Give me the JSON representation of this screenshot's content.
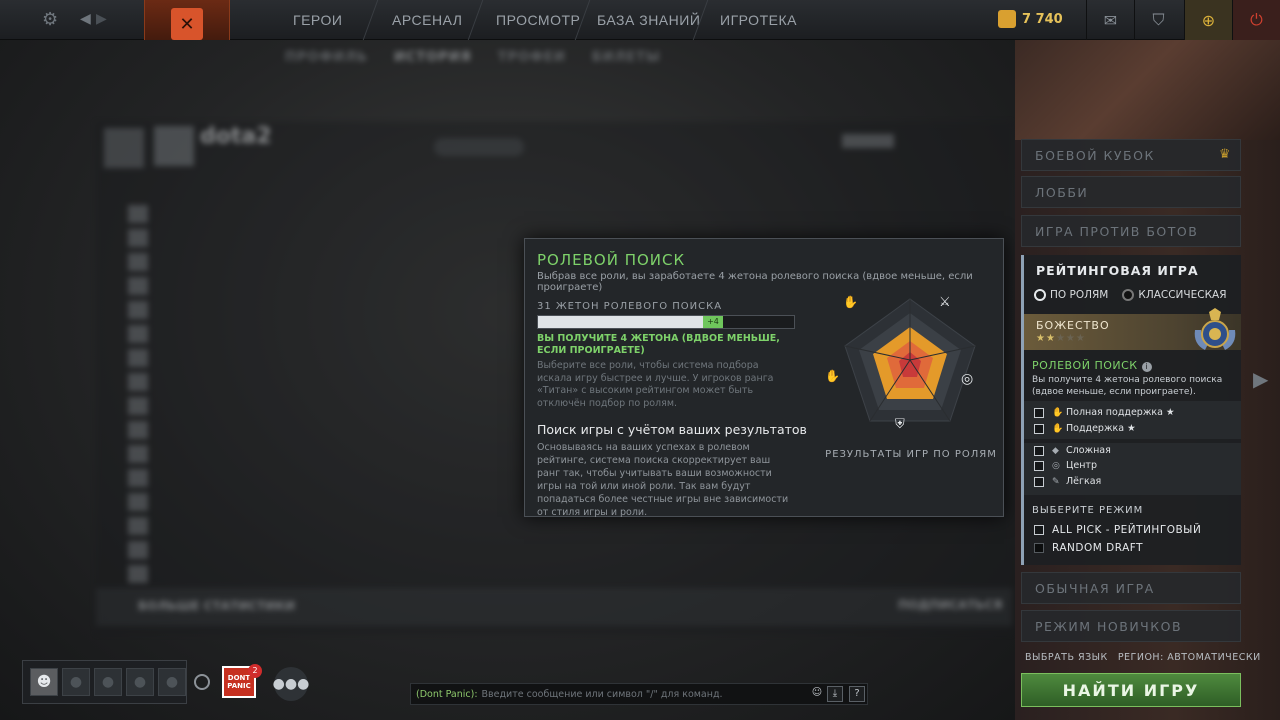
{
  "topbar": {
    "nav": [
      "ГЕРОИ",
      "АРСЕНАЛ",
      "ПРОСМОТР",
      "БАЗА ЗНАНИЙ",
      "ИГРОТЕКА"
    ],
    "gold": "7 740"
  },
  "background": {
    "subnav": [
      "ПРОФИЛЬ",
      "ИСТОРИЯ",
      "ТРОФЕИ",
      "БИЛЕТЫ"
    ],
    "profile_name": "dota2",
    "more_stats": "БОЛЬШЕ СТАТИСТИКИ",
    "subscribe": "ПОДПИСАТЬСЯ"
  },
  "popup": {
    "title": "РОЛЕВОЙ ПОИСК",
    "subtitle": "Выбрав все роли, вы заработаете 4 жетона ролевого поиска (вдвое меньше, если проиграете)",
    "token_label": "31 ЖЕТОН РОЛЕВОГО ПОИСКА",
    "token_progress": 0.7,
    "token_add_label": "+4",
    "token_note": "ВЫ ПОЛУЧИТЕ 4 ЖЕТОНА (ВДВОЕ МЕНЬШЕ, ЕСЛИ ПРОИГРАЕТЕ)",
    "token_desc": "Выберите все роли, чтобы система подбора искала игру быстрее и лучше. У игроков ранга «Титан» с высоким рейтингом может быть отключён подбор по ролям.",
    "perf_title": "Поиск игры с учётом ваших результатов",
    "perf_desc": "Основываясь на ваших успехах в ролевом рейтинге, система поиска скорректирует ваш ранг так, чтобы учитывать ваши возможности игры на той или иной роли. Так вам будут попадаться более честные игры вне зависимости от стиля игры и роли.",
    "radar_caption": "РЕЗУЛЬТАТЫ ИГР ПО РОЛЯМ",
    "radar_icons": [
      "hard-support-icon",
      "sword-icon",
      "target-icon",
      "shield-icon",
      "support-icon"
    ]
  },
  "right_panel": {
    "modes_top": [
      "БОЕВОЙ КУБОК",
      "ЛОББИ",
      "ИГРА ПРОТИВ БОТОВ"
    ],
    "ranked_title": "РЕЙТИНГОВАЯ ИГРА",
    "radio_roles": "ПО РОЛЯМ",
    "radio_classic": "КЛАССИЧЕСКАЯ",
    "rank_name": "БОЖЕСТВО",
    "rank_stars_on": "★★",
    "rank_stars_off": "★★★",
    "role_search_title": "РОЛЕВОЙ ПОИСК",
    "role_search_desc": "Вы получите 4 жетона ролевого поиска (вдвое меньше, если проиграете).",
    "roles": [
      {
        "label": "Полная поддержка",
        "icon": "✋",
        "star": "★"
      },
      {
        "label": "Поддержка",
        "icon": "✋",
        "star": "★"
      },
      {
        "label": "Сложная",
        "icon": "◆",
        "star": ""
      },
      {
        "label": "Центр",
        "icon": "◎",
        "star": ""
      },
      {
        "label": "Лёгкая",
        "icon": "✎",
        "star": ""
      }
    ],
    "choose_mode": "ВЫБЕРИТЕ РЕЖИМ",
    "mode_ranked": "ALL PICK - РЕЙТИНГОВЫЙ",
    "mode_random": "RANDOM DRAFT",
    "modes_bottom": [
      "ОБЫЧНАЯ ИГРА",
      "РЕЖИМ НОВИЧКОВ"
    ],
    "select_language": "ВЫБРАТЬ ЯЗЫК",
    "region": "РЕГИОН: АВТОМАТИЧЕСКИ",
    "find_game": "НАЙТИ ИГРУ"
  },
  "bottom": {
    "badge_text": "DONT PANIC",
    "badge_count": "2",
    "chat_channel": "(Dont Panic):",
    "chat_placeholder": "Введите сообщение или символ \"/\" для команд."
  },
  "colors": {
    "accent_green": "#7ed26a",
    "find_game_green": "#4f8a3e"
  }
}
